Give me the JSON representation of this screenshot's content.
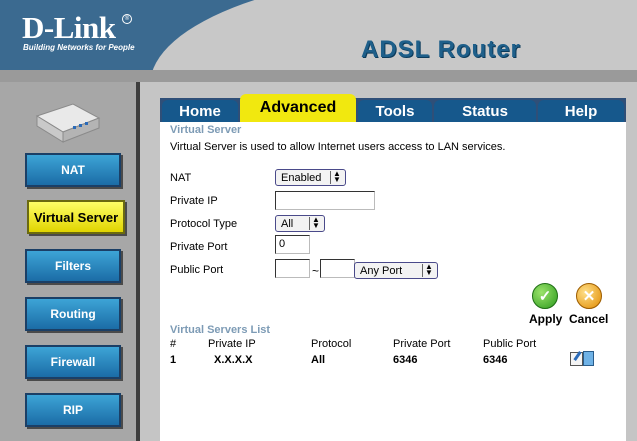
{
  "header": {
    "brand": "D-Link",
    "tagline": "Building Networks for People",
    "product": "ADSL Router"
  },
  "sidebar": {
    "items": [
      {
        "label": "NAT"
      },
      {
        "label": "Virtual Server",
        "active": true
      },
      {
        "label": "Filters"
      },
      {
        "label": "Routing"
      },
      {
        "label": "Firewall"
      },
      {
        "label": "RIP"
      }
    ]
  },
  "tabs": [
    {
      "label": "Home"
    },
    {
      "label": "Advanced",
      "active": true
    },
    {
      "label": "Tools"
    },
    {
      "label": "Status"
    },
    {
      "label": "Help"
    }
  ],
  "section": {
    "title": "Virtual Server",
    "description": "Virtual Server is used to allow Internet users access to LAN services."
  },
  "form": {
    "nat_label": "NAT",
    "nat_value": "Enabled",
    "private_ip_label": "Private IP",
    "private_ip_value": "",
    "protocol_label": "Protocol Type",
    "protocol_value": "All",
    "private_port_label": "Private Port",
    "private_port_value": "0",
    "public_port_label": "Public Port",
    "public_port_start": "",
    "public_port_end": "",
    "range_separator": "~",
    "port_preset_value": "Any Port"
  },
  "actions": {
    "apply_label": "Apply",
    "cancel_label": "Cancel"
  },
  "list": {
    "title": "Virtual Servers List",
    "columns": [
      "#",
      "Private IP",
      "Protocol",
      "Private Port",
      "Public Port"
    ],
    "rows": [
      {
        "num": "1",
        "private_ip": "X.X.X.X",
        "protocol": "All",
        "private_port": "6346",
        "public_port": "6346"
      }
    ]
  },
  "colors": {
    "header_blue": "#3b6a90",
    "tab_blue": "#16588c",
    "active_yellow": "#f1e80f",
    "nav_blue": "#1b6ca6",
    "section_title": "#7d9bb5"
  }
}
